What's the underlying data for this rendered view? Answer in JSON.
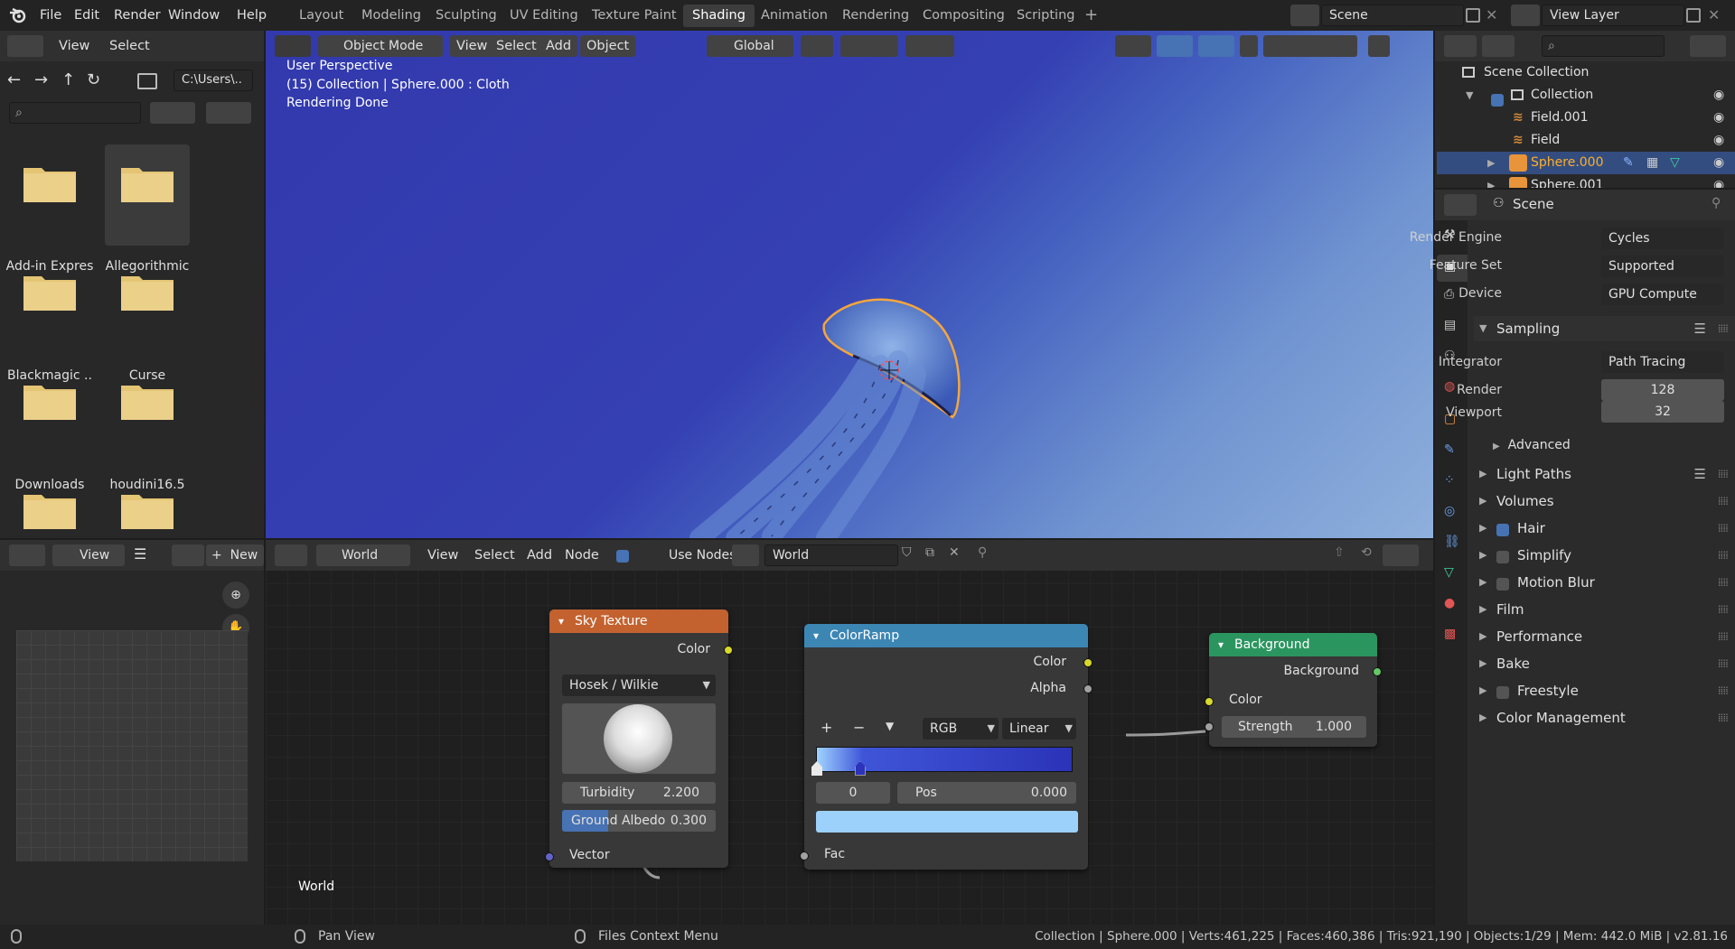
{
  "menus": [
    "File",
    "Edit",
    "Render",
    "Window",
    "Help"
  ],
  "workspaces": [
    "Layout",
    "Modeling",
    "Sculpting",
    "UV Editing",
    "Texture Paint",
    "Shading",
    "Animation",
    "Rendering",
    "Compositing",
    "Scripting"
  ],
  "active_workspace": "Shading",
  "scene_name": "Scene",
  "view_layer_name": "View Layer",
  "file_browser": {
    "menu_view": "View",
    "menu_select": "Select",
    "path": "C:\\Users\\..",
    "folders": [
      "Add-in Expres",
      "Allegorithmic",
      "Blackmagic ..",
      "Curse",
      "Downloads",
      "houdini16.5",
      "",
      ""
    ],
    "selected_folder": "Allegorithmic"
  },
  "viewport": {
    "mode": "Object Mode",
    "menus": [
      "View",
      "Select",
      "Add",
      "Object"
    ],
    "orientation": "Global",
    "overlay_lines": [
      "User Perspective",
      "(15) Collection | Sphere.000 : Cloth",
      "Rendering Done"
    ]
  },
  "outliner": {
    "scene_collection": "Scene Collection",
    "items": [
      {
        "name": "Collection",
        "selected": false
      },
      {
        "name": "Field.001",
        "selected": false
      },
      {
        "name": "Field",
        "selected": false
      },
      {
        "name": "Sphere.000",
        "selected": true
      },
      {
        "name": "Sphere.001",
        "selected": false
      }
    ]
  },
  "properties": {
    "context": "Scene",
    "render_engine_label": "Render Engine",
    "render_engine": "Cycles",
    "feature_set_label": "Feature Set",
    "feature_set": "Supported",
    "device_label": "Device",
    "device": "GPU Compute",
    "sampling": "Sampling",
    "integrator_label": "Integrator",
    "integrator": "Path Tracing",
    "render_label": "Render",
    "render_samples": "128",
    "viewport_label": "Viewport",
    "viewport_samples": "32",
    "advanced": "Advanced",
    "panels": [
      {
        "label": "Light Paths",
        "checkbox": null
      },
      {
        "label": "Volumes",
        "checkbox": null
      },
      {
        "label": "Hair",
        "checkbox": true
      },
      {
        "label": "Simplify",
        "checkbox": false
      },
      {
        "label": "Motion Blur",
        "checkbox": false
      },
      {
        "label": "Film",
        "checkbox": null
      },
      {
        "label": "Performance",
        "checkbox": null
      },
      {
        "label": "Bake",
        "checkbox": null
      },
      {
        "label": "Freestyle",
        "checkbox": false
      },
      {
        "label": "Color Management",
        "checkbox": null
      }
    ]
  },
  "image_editor": {
    "view": "View",
    "new": "New"
  },
  "node_editor": {
    "world_type": "World",
    "menus": [
      "View",
      "Select",
      "Add",
      "Node"
    ],
    "use_nodes": "Use Nodes",
    "use_nodes_checked": true,
    "world_name": "World",
    "footer_label": "World",
    "sky": {
      "title": "Sky Texture",
      "out_color": "Color",
      "model": "Hosek / Wilkie",
      "turbidity_label": "Turbidity",
      "turbidity": "2.200",
      "albedo_label": "Ground Albedo",
      "albedo": "0.300",
      "albedo_fraction": 0.3,
      "in_vector": "Vector"
    },
    "ramp": {
      "title": "ColorRamp",
      "out_color": "Color",
      "out_alpha": "Alpha",
      "color_mode": "RGB",
      "interpolation": "Linear",
      "index": "0",
      "pos_label": "Pos",
      "pos": "0.000",
      "in_fac": "Fac"
    },
    "bg": {
      "title": "Background",
      "out_bg": "Background",
      "in_color": "Color",
      "strength_label": "Strength",
      "strength": "1.000"
    }
  },
  "status": {
    "pan": "Pan View",
    "ctx": "Files Context Menu",
    "stats": "Collection | Sphere.000 | Verts:461,225 | Faces:460,386 | Tris:921,190 | Objects:1/29 | Mem: 442.0 MiB | v2.81.16"
  },
  "colors": {
    "sky_header": "#c3622f",
    "ramp_header": "#3c86b4",
    "bg_header": "#2b9560",
    "selection": "#4772b3",
    "folder": "#e4c574"
  }
}
